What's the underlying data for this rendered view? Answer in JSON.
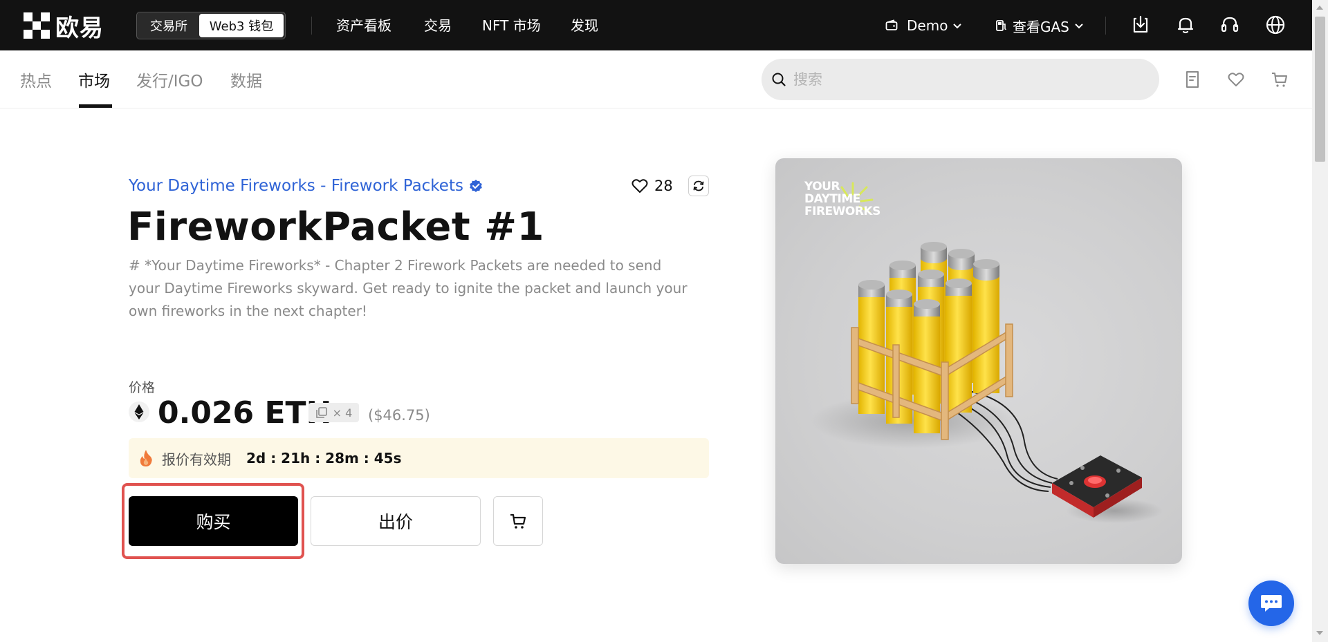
{
  "brand": {
    "name": "欧易"
  },
  "mode_switch": {
    "exchange": "交易所",
    "web3": "Web3 钱包"
  },
  "top_nav": [
    "资产看板",
    "交易",
    "NFT 市场",
    "发现"
  ],
  "account": {
    "wallet": "Demo",
    "gas": "查看GAS"
  },
  "sub_nav": {
    "tabs": [
      "热点",
      "市场",
      "发行/IGO",
      "数据"
    ],
    "active": "市场"
  },
  "search": {
    "placeholder": "搜索",
    "value": ""
  },
  "nft": {
    "collection": "Your Daytime Fireworks - Firework Packets",
    "verified": true,
    "likes": "28",
    "title": "FireworkPacket #1",
    "description": "# *Your Daytime Fireworks* - Chapter 2 Firework Packets are needed to send your Daytime Fireworks skyward. Get ready to ignite the packet and launch your own fireworks in the next chapter!",
    "image_logo": [
      "YOUR",
      "DAYTIME",
      "FIREWORKS"
    ]
  },
  "price": {
    "label": "价格",
    "value": "0.026 ETH",
    "quantity": "× 4",
    "usd": "($46.75)"
  },
  "offer": {
    "label": "报价有效期",
    "countdown": "2d : 21h : 28m : 45s"
  },
  "actions": {
    "buy": "购买",
    "bid": "出价"
  },
  "colors": {
    "accent_blue": "#2f63d6",
    "highlight": "#e0524f",
    "chat": "#2466e8"
  }
}
